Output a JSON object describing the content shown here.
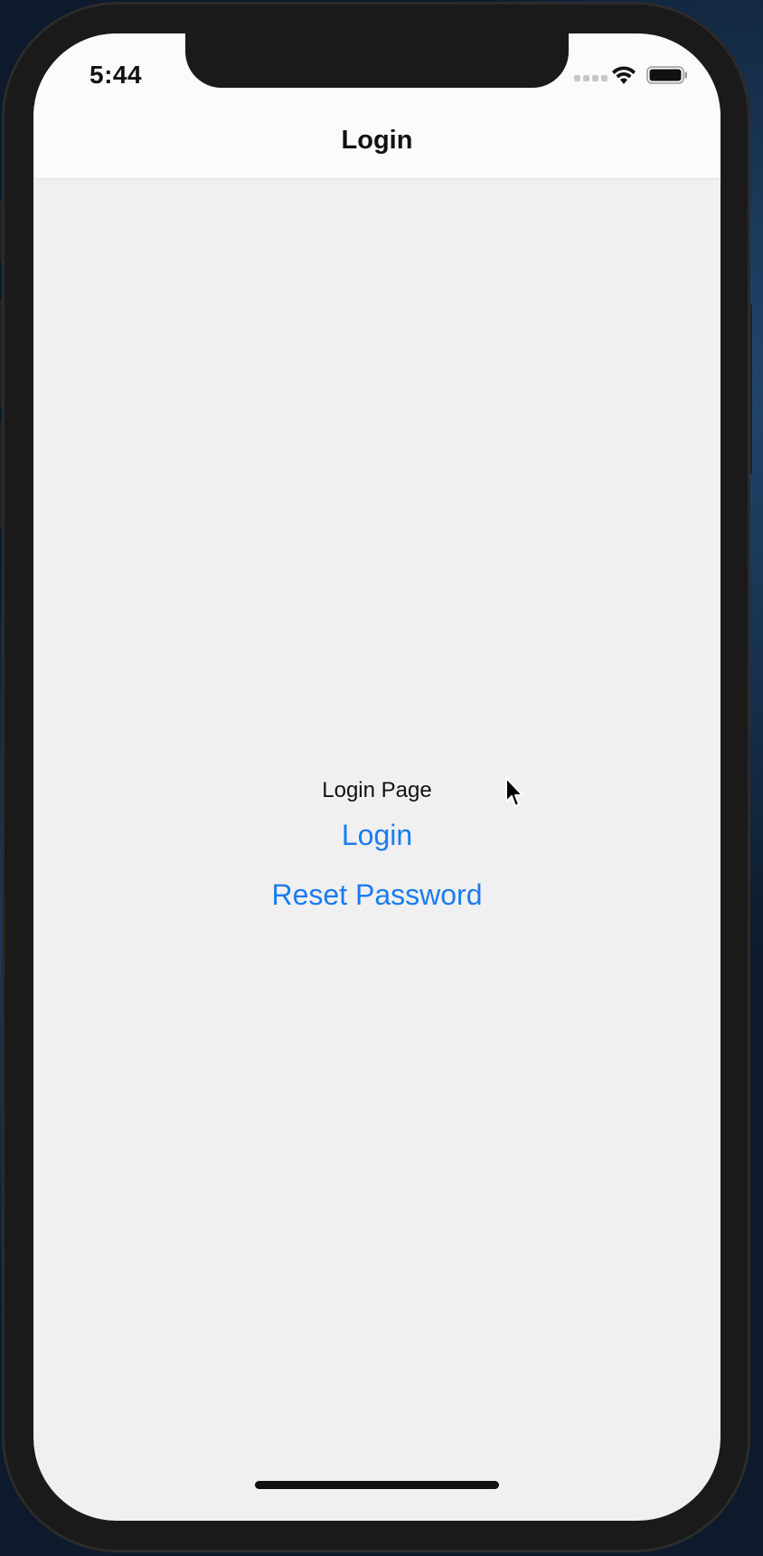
{
  "status_bar": {
    "time": "5:44",
    "icons": [
      "signal-icon",
      "wifi-icon",
      "battery-icon"
    ]
  },
  "nav_bar": {
    "title": "Login"
  },
  "main": {
    "page_label": "Login Page",
    "login_button_label": "Login",
    "reset_button_label": "Reset Password"
  },
  "colors": {
    "accent": "#1b7cf0",
    "background": "#f0f0f0",
    "nav_background": "#fbfbfb",
    "text": "#111111"
  }
}
